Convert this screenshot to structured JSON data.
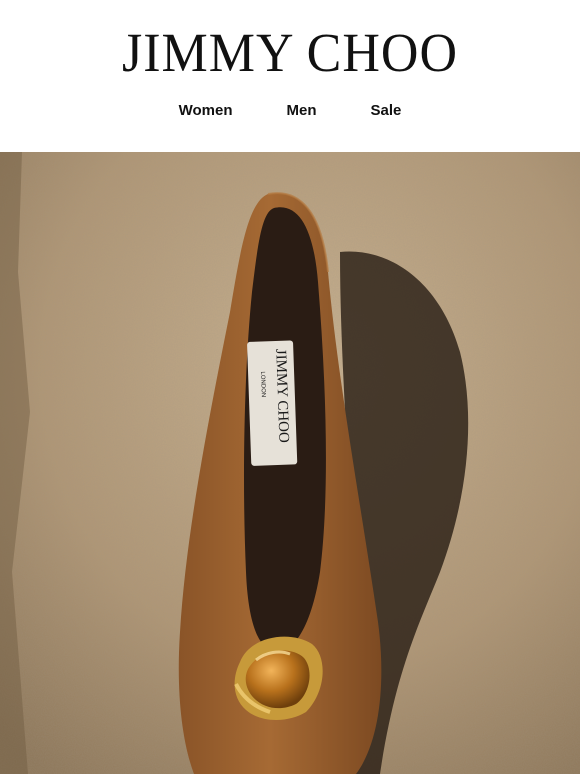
{
  "brand": {
    "name": "JIMMY CHOO"
  },
  "nav": {
    "items": [
      {
        "label": "Women"
      },
      {
        "label": "Men"
      },
      {
        "label": "Sale"
      }
    ]
  },
  "hero": {
    "insole_label_brand": "JIMMY CHOO",
    "insole_label_city": "LONDON",
    "colors": {
      "stone": "#b39a79",
      "suede": "#8e5a2b",
      "interior": "#2a1c14",
      "gold": "#c79a3a",
      "amber": "#b8711c"
    }
  }
}
